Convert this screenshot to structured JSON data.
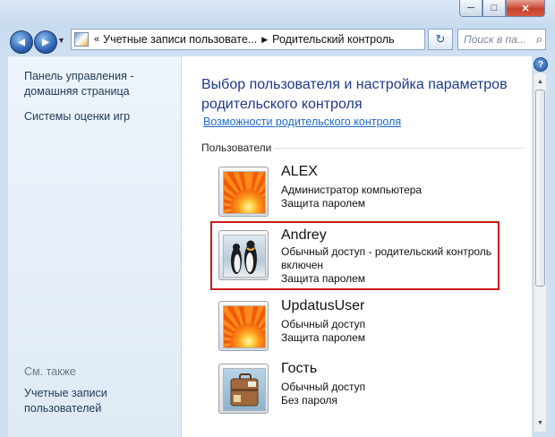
{
  "window": {
    "controls": {
      "minimize": "─",
      "maximize": "□",
      "close": "✕"
    }
  },
  "toolbar": {
    "back_glyph": "◀",
    "forward_glyph": "▶",
    "dropdown_glyph": "▼",
    "breadcrumb": [
      "Учетные записи пользовате...",
      "Родительский контроль"
    ],
    "breadcrumb_prefix": "«",
    "separator": "▶",
    "refresh_glyph": "↻",
    "search_placeholder": "Поиск в па...",
    "search_glyph": "⌕"
  },
  "sidebar": {
    "home_link": "Панель управления - домашняя страница",
    "home_line1": "Панель управления -",
    "home_line2": "домашняя страница",
    "ratings_link": "Системы оценки игр",
    "see_also": "См. также",
    "accounts_line1": "Учетные записи",
    "accounts_line2": "пользователей"
  },
  "main": {
    "title_line1": "Выбор пользователя и настройка параметров",
    "title_line2": "родительского контроля",
    "features_link": "Возможности родительского контроля",
    "users_section": "Пользователи",
    "help_glyph": "?"
  },
  "users": [
    {
      "name": "ALEX",
      "lines": [
        "Администратор компьютера",
        "Защита паролем"
      ],
      "picture": "flower"
    },
    {
      "name": "Andrey",
      "lines": [
        "Обычный доступ - родительский контроль",
        "включен",
        "Защита паролем"
      ],
      "picture": "penguins"
    },
    {
      "name": "UpdatusUser",
      "lines": [
        "Обычный доступ",
        "Защита паролем"
      ],
      "picture": "flower"
    },
    {
      "name": "Гость",
      "lines": [
        "Обычный доступ",
        "Без пароля"
      ],
      "picture": "suitcase"
    }
  ],
  "colors": {
    "highlight": "#cc1a1a",
    "title": "#1e3a8a",
    "link": "#1e6ad0"
  }
}
